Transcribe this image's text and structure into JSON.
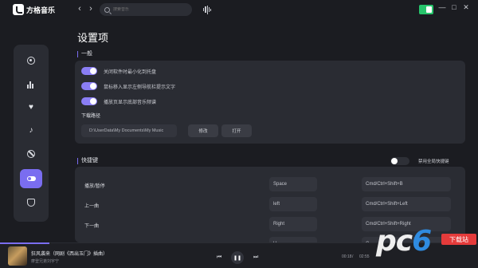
{
  "app": {
    "name": "方格音乐"
  },
  "search": {
    "placeholder": "搜索音乐"
  },
  "page": {
    "title": "设置项"
  },
  "general": {
    "title": "一般",
    "toggles": [
      {
        "label": "关闭软件时最小化到托盘",
        "on": true
      },
      {
        "label": "鼠标移入显示左侧导航栏提示文字",
        "on": true
      },
      {
        "label": "播放页显示底部音乐频谱",
        "on": true
      }
    ],
    "download_label": "下载路径",
    "download_path": "D:\\UserData\\My Documents\\My Music",
    "modify_button": "修改",
    "open_button": "打开"
  },
  "shortcuts": {
    "title": "快捷键",
    "global_label": "禁用全局快捷键",
    "global_enabled": false,
    "rows": [
      {
        "name": "播放/暂停",
        "key": "Space",
        "global_key": "Cmd/Ctrl+Shift+B"
      },
      {
        "name": "上一曲",
        "key": "left",
        "global_key": "Cmd/Ctrl+Shift+Left"
      },
      {
        "name": "下一曲",
        "key": "Right",
        "global_key": "Cmd/Ctrl+Shift+Right"
      },
      {
        "name": "音",
        "key": "U",
        "global_key": "C"
      }
    ]
  },
  "player": {
    "song": "狂风袭来（网剧《西出玉门》插曲）",
    "artist": "摩登兄弟刘宇宁",
    "current_time": "00:18",
    "total_time": "02:55",
    "progress": 0.103
  },
  "watermark": {
    "text_pc": "pc",
    "text_six": "6",
    "tag": "下载站"
  },
  "colors": {
    "accent": "#7a6df0",
    "badge": "#27c46b",
    "bg": "#1b1c21",
    "panel": "#2a2c33"
  }
}
